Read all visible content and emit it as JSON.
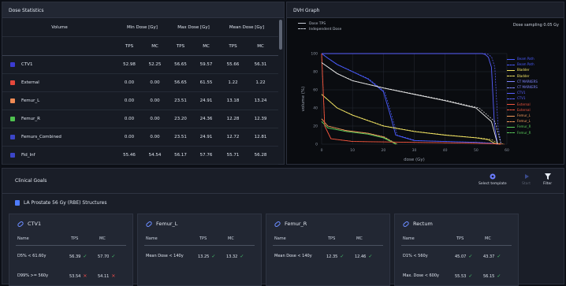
{
  "dose_stats": {
    "title": "Dose Statistics",
    "header": {
      "volume": "Volume",
      "min": "Min Dose [Gy]",
      "max": "Max Dose [Gy]",
      "mean": "Mean Dose [Gy]",
      "tps": "TPS",
      "mc": "MC"
    },
    "rows": [
      {
        "name": "CTV1",
        "color": "#3b3bd1",
        "min_tps": "52.98",
        "min_mc": "52.25",
        "max_tps": "56.65",
        "max_mc": "59.57",
        "mean_tps": "55.66",
        "mean_mc": "56.31"
      },
      {
        "name": "External",
        "color": "#e5483c",
        "min_tps": "0.00",
        "min_mc": "0.00",
        "max_tps": "56.65",
        "max_mc": "61.55",
        "mean_tps": "1.22",
        "mean_mc": "1.22"
      },
      {
        "name": "Femur_L",
        "color": "#f08a54",
        "min_tps": "0.00",
        "min_mc": "0.00",
        "max_tps": "23.51",
        "max_mc": "24.91",
        "mean_tps": "13.18",
        "mean_mc": "13.24"
      },
      {
        "name": "Femur_R",
        "color": "#4fc24f",
        "min_tps": "0.00",
        "min_mc": "0.00",
        "max_tps": "23.20",
        "max_mc": "24.36",
        "mean_tps": "12.28",
        "mean_mc": "12.39"
      },
      {
        "name": "Femurs_Combined",
        "color": "#3c46c8",
        "min_tps": "0.00",
        "min_mc": "0.00",
        "max_tps": "23.51",
        "max_mc": "24.91",
        "mean_tps": "12.72",
        "mean_mc": "12.81"
      },
      {
        "name": "Fid_Inf",
        "color": "#3c46c8",
        "min_tps": "55.46",
        "min_mc": "54.54",
        "max_tps": "56.17",
        "max_mc": "57.76",
        "mean_tps": "55.71",
        "mean_mc": "56.28"
      }
    ]
  },
  "dvh": {
    "title": "DVH Graph",
    "sampling": "Dose sampling 0.05 Gy",
    "legend_top": [
      "Dose TPS",
      "Independent Dose"
    ],
    "legend_right": [
      {
        "label": "Beam Path",
        "color": "#4a5cff",
        "dashed": false
      },
      {
        "label": "Beam Path",
        "color": "#4a5cff",
        "dashed": true
      },
      {
        "label": "Bladder",
        "color": "#f2e463",
        "dashed": false
      },
      {
        "label": "Bladder",
        "color": "#f2e463",
        "dashed": true
      },
      {
        "label": "CT MARKERS",
        "color": "#7f86ff",
        "dashed": false
      },
      {
        "label": "CT MARKERS",
        "color": "#7f86ff",
        "dashed": true
      },
      {
        "label": "CTV1",
        "color": "#5860ff",
        "dashed": false
      },
      {
        "label": "CTV1",
        "color": "#5860ff",
        "dashed": true
      },
      {
        "label": "External",
        "color": "#f0553d",
        "dashed": false
      },
      {
        "label": "External",
        "color": "#f0553d",
        "dashed": true
      },
      {
        "label": "Femur_L",
        "color": "#f39a5b",
        "dashed": false
      },
      {
        "label": "Femur_L",
        "color": "#f39a5b",
        "dashed": true
      },
      {
        "label": "Femur_R",
        "color": "#5acb5a",
        "dashed": false
      },
      {
        "label": "Femur_R",
        "color": "#5acb5a",
        "dashed": true
      }
    ],
    "chart_data": {
      "type": "line",
      "xlabel": "dose (Gy)",
      "ylabel": "volume (%)",
      "xlim": [
        0,
        60
      ],
      "ylim": [
        0,
        100
      ],
      "x_ticks": [
        "0",
        "10",
        "20",
        "30",
        "40",
        "50",
        "60"
      ],
      "y_ticks": [
        "0",
        "20",
        "40",
        "60",
        "80",
        "100"
      ],
      "series": [
        {
          "name": "CTV1",
          "color": "#5860ff",
          "x": [
            0,
            52,
            53,
            54,
            55,
            56,
            57
          ],
          "y": [
            100,
            100,
            99,
            96,
            85,
            20,
            0
          ]
        },
        {
          "name": "Beam Path",
          "color": "#4a5cff",
          "x": [
            0,
            2,
            5,
            10,
            15,
            20,
            22,
            24,
            30,
            40,
            50,
            55,
            57
          ],
          "y": [
            100,
            95,
            88,
            80,
            72,
            58,
            35,
            10,
            4,
            3,
            2,
            1,
            0
          ]
        },
        {
          "name": "Bladder",
          "color": "#f2e463",
          "x": [
            0,
            5,
            10,
            20,
            30,
            40,
            50,
            54,
            56,
            58
          ],
          "y": [
            55,
            40,
            32,
            20,
            14,
            10,
            7,
            5,
            1,
            0
          ]
        },
        {
          "name": "Femur_L",
          "color": "#f39a5b",
          "x": [
            0,
            2,
            8,
            15,
            20,
            23,
            24
          ],
          "y": [
            28,
            20,
            15,
            12,
            8,
            2,
            0
          ]
        },
        {
          "name": "Femur_R",
          "color": "#5acb5a",
          "x": [
            0,
            2,
            8,
            15,
            20,
            23,
            24
          ],
          "y": [
            25,
            18,
            14,
            11,
            7,
            2,
            0
          ]
        },
        {
          "name": "External",
          "color": "#f0553d",
          "x": [
            0,
            1,
            3,
            10,
            30,
            50,
            56,
            58
          ],
          "y": [
            100,
            20,
            6,
            3,
            2,
            1,
            0.5,
            0
          ]
        },
        {
          "name": "Rectum",
          "color": "#e6e6e6",
          "x": [
            0,
            5,
            10,
            20,
            30,
            40,
            50,
            55,
            57
          ],
          "y": [
            90,
            78,
            70,
            62,
            55,
            48,
            40,
            25,
            0
          ]
        }
      ]
    }
  },
  "clinical": {
    "title": "Clinical Goals",
    "structure_set": "LA Prostate 56 Gy (RBE) Structures",
    "toolbar": {
      "select": "Select template",
      "start": "Start",
      "filter": "Filter"
    },
    "col_headers": {
      "name": "Name",
      "tps": "TPS",
      "mc": "MC"
    },
    "cards": [
      {
        "title": "CTV1",
        "goals": [
          {
            "name": "D5% < 61.60y",
            "tps": "56.39",
            "mc": "57.70",
            "status": [
              "ok"
            ]
          },
          {
            "name": "D99% >= 560y",
            "tps": "53.54",
            "mc": "54.11",
            "status": [
              "fail"
            ]
          }
        ]
      },
      {
        "title": "Femur_L",
        "goals": [
          {
            "name": "Mean Dose < 140y",
            "tps": "13.25",
            "mc": "13.32",
            "status": [
              "ok"
            ]
          }
        ]
      },
      {
        "title": "Femur_R",
        "goals": [
          {
            "name": "Mean Dose < 140y",
            "tps": "12.35",
            "mc": "12.46",
            "status": [
              "ok"
            ]
          }
        ]
      },
      {
        "title": "Rectum",
        "goals": [
          {
            "name": "D1% < 560y",
            "tps": "45.07",
            "mc": "43.37",
            "status": [
              "ok"
            ]
          },
          {
            "name": "Max. Dose < 600y",
            "tps": "55.53",
            "mc": "56.15",
            "status": [
              "ok"
            ]
          }
        ]
      }
    ]
  }
}
